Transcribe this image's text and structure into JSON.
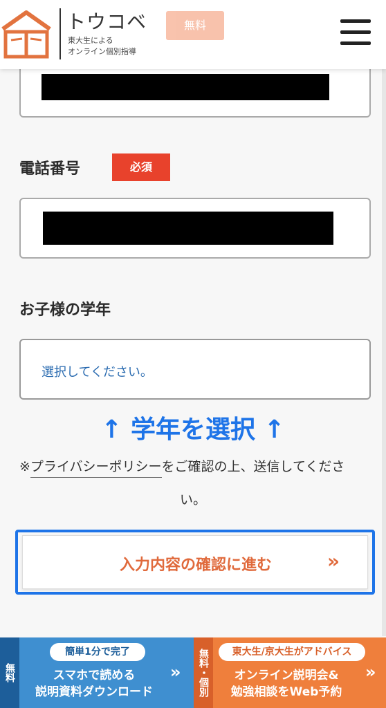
{
  "header": {
    "logo_name": "トウコベ",
    "tagline_1": "東大生による",
    "tagline_2": "オンライン個別指導",
    "badge_label": "無料"
  },
  "form": {
    "phone": {
      "label": "電話番号",
      "required_label": "必須"
    },
    "grade": {
      "label": "お子様の学年",
      "placeholder": "選択してください。"
    }
  },
  "annotation": "↑ 学年を選択 ↑",
  "notice": {
    "prefix": "※",
    "link": "プライバシーポリシー",
    "suffix": "をご確認の上、送信してくださ",
    "line2": "い。"
  },
  "confirm_button": {
    "label": "入力内容の確認に進む",
    "arrow": "»"
  },
  "cta": {
    "left": {
      "tag": "無料",
      "pill": "簡単1分で完了",
      "line1": "スマホで読める",
      "line2": "説明資料ダウンロード",
      "arrow": "»"
    },
    "right": {
      "tag": "無料・個別",
      "pill": "東大生/京大生がアドバイス",
      "line1": "オンライン説明会&",
      "line2": "勉強相談をWeb予約",
      "arrow": "»"
    }
  },
  "colors": {
    "accent_blue": "#1e74e8",
    "required_red": "#e8422c",
    "cta_blue": "#3f8fd0",
    "cta_orange": "#ef7f3c",
    "logo_orange": "#e2733f"
  }
}
